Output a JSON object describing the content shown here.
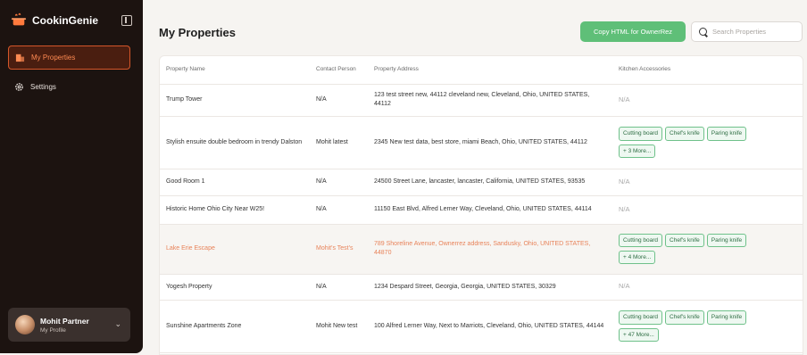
{
  "app": {
    "name": "CookinGenie"
  },
  "sidebar": {
    "items": [
      {
        "label": "My Properties",
        "active": true
      },
      {
        "label": "Settings",
        "active": false
      }
    ],
    "profile": {
      "name": "Mohit Partner",
      "subtitle": "My Profile"
    }
  },
  "header": {
    "title": "My Properties",
    "copy_button": "Copy HTML for OwnerRez",
    "search_placeholder": "Search Properties"
  },
  "table": {
    "columns": [
      "Property Name",
      "Contact Person",
      "Property Address",
      "Kitchen Accessories"
    ],
    "rows": [
      {
        "name": "Trump Tower",
        "contact": "N/A",
        "address": "123 test street new, 44112 cleveland new, Cleveland, Ohio, UNITED STATES, 44112",
        "na": "N/A"
      },
      {
        "name": "Stylish ensuite double bedroom in trendy Dalston",
        "contact": "Mohit latest",
        "address": "2345 New test data, best store, miami Beach, Ohio, UNITED STATES, 44112",
        "tags": [
          "Cutting board",
          "Chef's knife",
          "Paring knife"
        ],
        "more": "+ 3 More..."
      },
      {
        "name": "Good Room 1",
        "contact": "N/A",
        "address": "24500 Street Lane, lancaster, lancaster, California, UNITED STATES, 93535",
        "na": "N/A"
      },
      {
        "name": "Historic Home Ohio City Near W25!",
        "contact": "N/A",
        "address": "11150 East Blvd, Alfred Lerner Way, Cleveland, Ohio, UNITED STATES, 44114",
        "na": "N/A"
      },
      {
        "name": "Lake Erie Escape",
        "contact": "Mohit's Test's",
        "address": "789 Shoreline Avenue, Ownerrez address, Sandusky, Ohio, UNITED STATES, 44870",
        "tags": [
          "Cutting board",
          "Chef's knife",
          "Paring knife"
        ],
        "more": "+ 4 More..."
      },
      {
        "name": "Yogesh Property",
        "contact": "N/A",
        "address": "1234 Despard Street, Georgia, Georgia, UNITED STATES, 30329",
        "na": "N/A"
      },
      {
        "name": "Sunshine Apartments Zone",
        "contact": "Mohit New test",
        "address": "100 Alfred Lerner Way, Next to Marriots, Cleveland, Ohio, UNITED STATES, 44144",
        "tags": [
          "Cutting board",
          "Chef's knife",
          "Paring knife"
        ],
        "more": "+ 47 More..."
      }
    ]
  },
  "colors": {
    "accent": "#ff8a52",
    "copy_button": "#5fbf78",
    "sidebar_bg": "#1c1310",
    "highlight_text": "#e8835a"
  }
}
